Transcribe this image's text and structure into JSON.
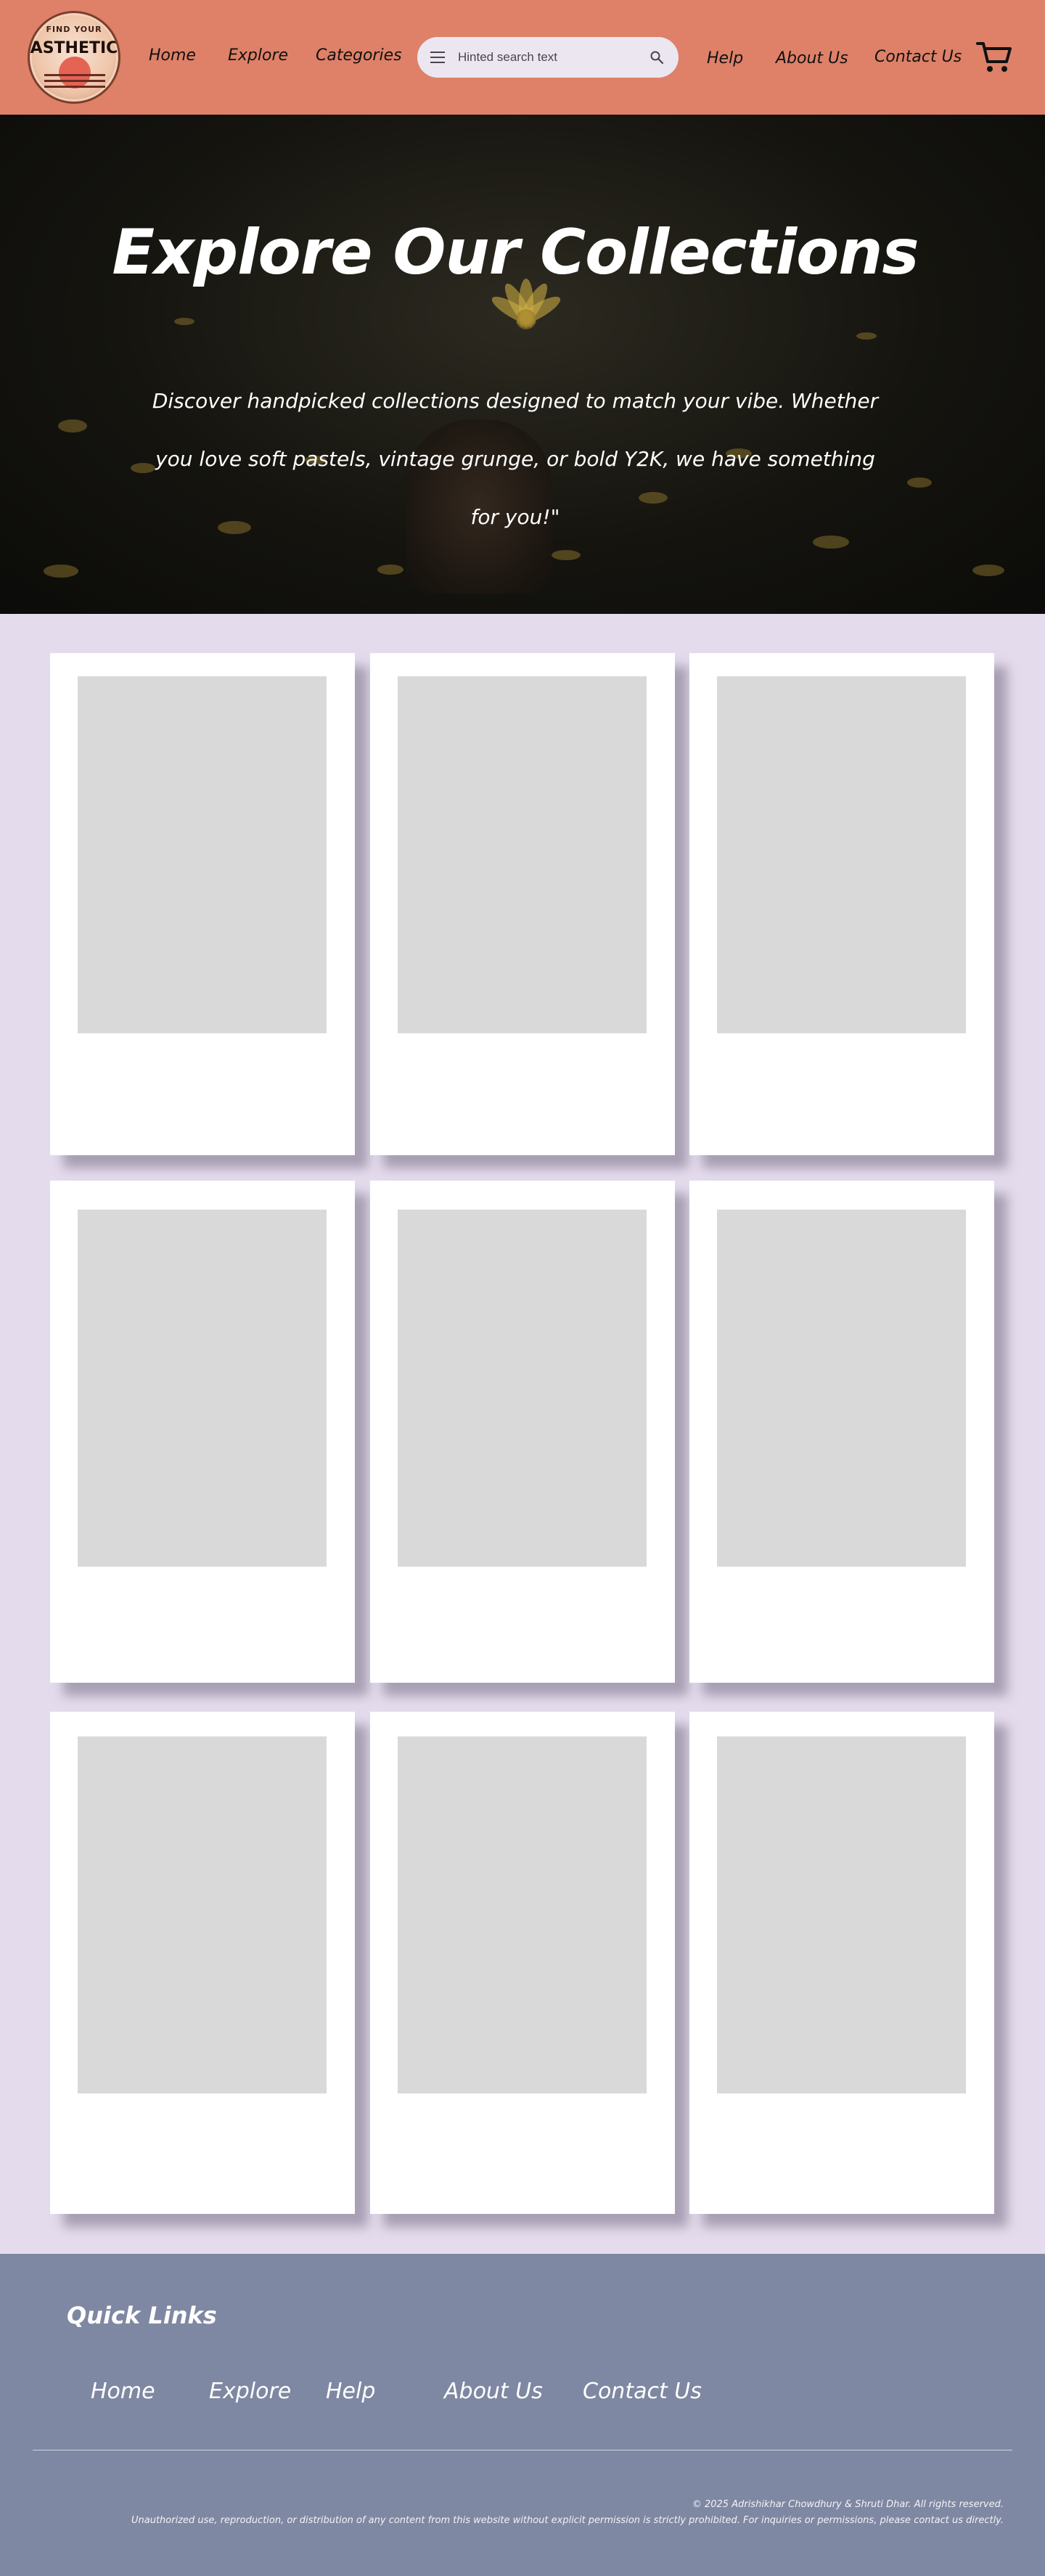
{
  "header": {
    "logo": {
      "top_text": "FIND YOUR",
      "main_text": "ASTHETIC"
    },
    "nav_left": [
      "Home",
      "Explore",
      "Categories"
    ],
    "search": {
      "placeholder": "Hinted search text"
    },
    "nav_right": [
      "Help",
      "About Us",
      "Contact Us"
    ],
    "icons": [
      "menu-icon",
      "search-icon",
      "cart-icon"
    ]
  },
  "hero": {
    "title": "Explore Our Collections",
    "subtitle": "Discover handpicked collections designed to match your vibe. Whether you love soft pastels, vintage grunge, or bold Y2K, we have something for you!\""
  },
  "collections": {
    "count": 9
  },
  "footer": {
    "title": "Quick Links",
    "links": [
      "Home",
      "Explore",
      "Help",
      "About Us",
      "Contact Us"
    ],
    "copyright": "© 2025 Adrishikhar Chowdhury & Shruti Dhar. All rights reserved.",
    "notice": "Unauthorized use, reproduction, or distribution of any content from this website without explicit permission is strictly prohibited. For inquiries or permissions, please contact us directly."
  },
  "colors": {
    "header_bg": "#de8168",
    "page_bg": "#e4dcec",
    "footer_bg": "#7f88a2",
    "search_bg": "#ece6f0",
    "placeholder_bg": "#d9d9d9"
  }
}
